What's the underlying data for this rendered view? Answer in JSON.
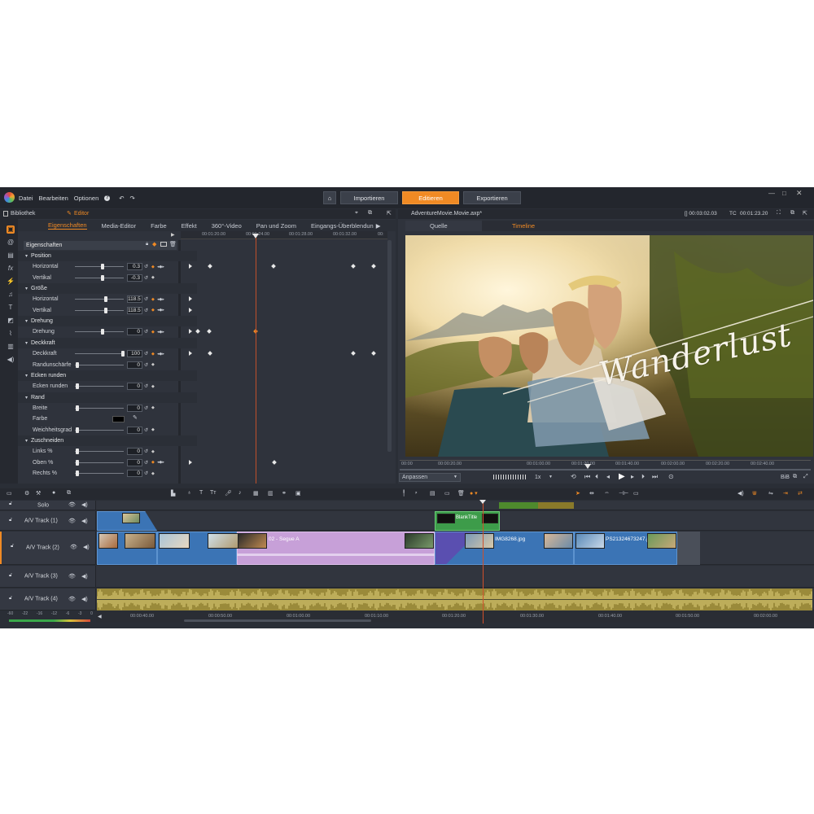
{
  "menu": {
    "file": "Datei",
    "edit": "Bearbeiten",
    "options": "Optionen"
  },
  "modes": {
    "import": "Importieren",
    "edit": "Editieren",
    "export": "Exportieren"
  },
  "left_panel": {
    "tab_library": "Bibliothek",
    "tab_editor": "Editor",
    "subtabs": [
      "Eigenschaften",
      "Media-Editor",
      "Farbe",
      "Effekt",
      "360°-Video",
      "Pan und Zoom",
      "Eingangs-Überblendun"
    ],
    "props_header": "Eigenschaften",
    "ruler": [
      "00:01:20.00",
      "00:01:24.00",
      "00:01:28.00",
      "00:01:32.00",
      "00:"
    ],
    "rows": [
      {
        "label": "Position",
        "group": true
      },
      {
        "label": "Horizontal",
        "value": "0.3"
      },
      {
        "label": "Vertikal",
        "value": "-0.3"
      },
      {
        "label": "Größe",
        "group": true
      },
      {
        "label": "Horizontal",
        "value": "118.5"
      },
      {
        "label": "Vertikal",
        "value": "118.5"
      },
      {
        "label": "Drehung",
        "group": true
      },
      {
        "label": "Drehung",
        "value": "0"
      },
      {
        "label": "Deckkraft",
        "group": true
      },
      {
        "label": "Deckkraft",
        "value": "100"
      },
      {
        "label": "Randunschärfe",
        "value": "0"
      },
      {
        "label": "Ecken runden",
        "group": true
      },
      {
        "label": "Ecken runden",
        "value": "0"
      },
      {
        "label": "Rand",
        "group": true
      },
      {
        "label": "Breite",
        "value": "0"
      },
      {
        "label": "Farbe",
        "value": ""
      },
      {
        "label": "Weichheitsgrad",
        "value": "0"
      },
      {
        "label": "Zuschneiden",
        "group": true
      },
      {
        "label": "Links %",
        "value": "0"
      },
      {
        "label": "Oben %",
        "value": "0"
      },
      {
        "label": "Rechts %",
        "value": "0"
      }
    ]
  },
  "preview": {
    "filename": "AdventureMovie.Movie.axp*",
    "duration": "[] 00:03:02.03",
    "tc_label": "TC",
    "timecode": "00:01:23.20",
    "tab_source": "Quelle",
    "tab_timeline": "Timeline",
    "overlay_text": "Wanderlust",
    "ruler": [
      "00:00",
      "00:00:20.00",
      "00:01:00.00",
      "00:01:20.00",
      "00:01:40.00",
      "00:02:00.00",
      "00:02:20.00",
      "00:02:40.00"
    ],
    "fit": "Anpassen",
    "speed": "1x",
    "pip": "BiB"
  },
  "timeline": {
    "tracks": [
      {
        "name": "Solo"
      },
      {
        "name": "A/V Track (1)"
      },
      {
        "name": "A/V Track (2)"
      },
      {
        "name": "A/V Track (3)"
      },
      {
        "name": "A/V Track (4)"
      }
    ],
    "clips": {
      "segue": "02 - Segue A",
      "blank_title": "BlankTitle",
      "img1": "IMG8268.jpg",
      "img2": "PS21324673247.j..."
    },
    "ruler": [
      "00:00:40.00",
      "00:00:50.00",
      "00:01:00.00",
      "00:01:10.00",
      "00:01:20.00",
      "00:01:30.00",
      "00:01:40.00",
      "00:01:50.00",
      "00:02:00.00"
    ],
    "meter": [
      "-60",
      "-22",
      "-16",
      "-12",
      "-6",
      "-3",
      "0"
    ]
  },
  "colors": {
    "accent": "#f08a24",
    "clip_blue": "#3b74b5",
    "clip_purple": "#c7a0d8",
    "audio": "#b5a24a"
  }
}
